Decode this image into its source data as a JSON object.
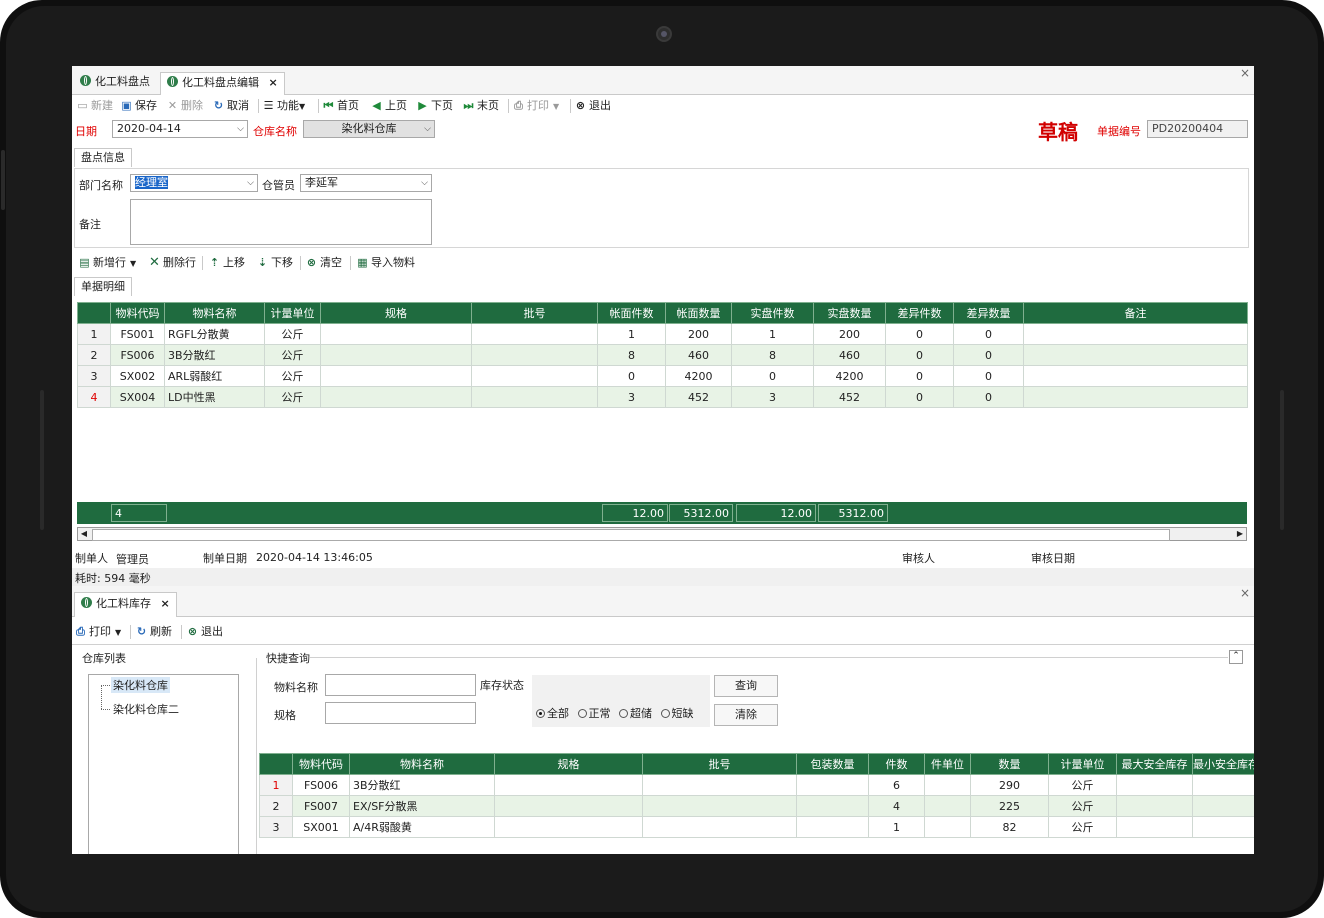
{
  "window1": {
    "tabs": [
      {
        "label": "化工料盘点"
      },
      {
        "label": "化工料盘点编辑",
        "close": "×"
      }
    ],
    "close": "×",
    "toolbar": {
      "new": "新建",
      "save": "保存",
      "delete": "删除",
      "cancel": "取消",
      "function": "功能",
      "first": "首页",
      "prev": "上页",
      "next": "下页",
      "last": "末页",
      "print": "打印",
      "exit": "退出"
    },
    "header": {
      "date_label": "日期",
      "date_value": "2020-04-14",
      "warehouse_label": "仓库名称",
      "warehouse_value": "染化料仓库",
      "status": "草稿",
      "doc_no_label": "单据编号",
      "doc_no_value": "PD20200404"
    },
    "info_tab": "盘点信息",
    "info": {
      "dept_label": "部门名称",
      "dept_value": "经理室",
      "keeper_label": "仓管员",
      "keeper_value": "李延军",
      "remark_label": "备注",
      "remark_value": ""
    },
    "row_toolbar": {
      "add_row": "新增行",
      "delete_row": "删除行",
      "move_up": "上移",
      "move_down": "下移",
      "clear": "清空",
      "import": "导入物料"
    },
    "detail_tab": "单据明细",
    "grid": {
      "columns": [
        "",
        "物料代码",
        "物料名称",
        "计量单位",
        "规格",
        "批号",
        "帐面件数",
        "帐面数量",
        "实盘件数",
        "实盘数量",
        "差异件数",
        "差异数量",
        "备注"
      ],
      "rows": [
        [
          "1",
          "FS001",
          "RGFL分散黄",
          "公斤",
          "",
          "",
          "1",
          "200",
          "1",
          "200",
          "0",
          "0",
          ""
        ],
        [
          "2",
          "FS006",
          "3B分散红",
          "公斤",
          "",
          "",
          "8",
          "460",
          "8",
          "460",
          "0",
          "0",
          ""
        ],
        [
          "3",
          "SX002",
          "ARL弱酸红",
          "公斤",
          "",
          "",
          "0",
          "4200",
          "0",
          "4200",
          "0",
          "0",
          ""
        ],
        [
          "4",
          "SX004",
          "LD中性黑",
          "公斤",
          "",
          "",
          "3",
          "452",
          "3",
          "452",
          "0",
          "0",
          ""
        ]
      ],
      "summary": {
        "count": "4",
        "book_pieces": "12.00",
        "book_qty": "5312.00",
        "actual_pieces": "12.00",
        "actual_qty": "5312.00"
      }
    },
    "footer": {
      "maker_label": "制单人",
      "maker_value": "管理员",
      "date_label": "制单日期",
      "date_value": "2020-04-14 13:46:05",
      "auditor_label": "审核人",
      "audit_date_label": "审核日期"
    },
    "elapsed": "耗时: 594 毫秒"
  },
  "window2": {
    "tab": {
      "label": "化工料库存",
      "close": "×"
    },
    "close": "×",
    "toolbar": {
      "print": "打印",
      "refresh": "刷新",
      "exit": "退出"
    },
    "warehouse_list": {
      "title": "仓库列表",
      "items": [
        "染化料仓库",
        "染化料仓库二"
      ]
    },
    "query": {
      "title": "快捷查询",
      "material_label": "物料名称",
      "spec_label": "规格",
      "status_label": "库存状态",
      "options": [
        "全部",
        "正常",
        "超储",
        "短缺"
      ],
      "selected": "全部",
      "search_btn": "查询",
      "clear_btn": "清除"
    },
    "grid": {
      "columns": [
        "",
        "物料代码",
        "物料名称",
        "规格",
        "批号",
        "包装数量",
        "件数",
        "件单位",
        "数量",
        "计量单位",
        "最大安全库存",
        "最小安全库存"
      ],
      "rows": [
        [
          "1",
          "FS006",
          "3B分散红",
          "",
          "",
          "",
          "6",
          "",
          "290",
          "公斤",
          "",
          ""
        ],
        [
          "2",
          "FS007",
          "EX/SF分散黑",
          "",
          "",
          "",
          "4",
          "",
          "225",
          "公斤",
          "",
          ""
        ],
        [
          "3",
          "SX001",
          "A/4R弱酸黄",
          "",
          "",
          "",
          "1",
          "",
          "82",
          "公斤",
          "",
          ""
        ]
      ]
    }
  }
}
